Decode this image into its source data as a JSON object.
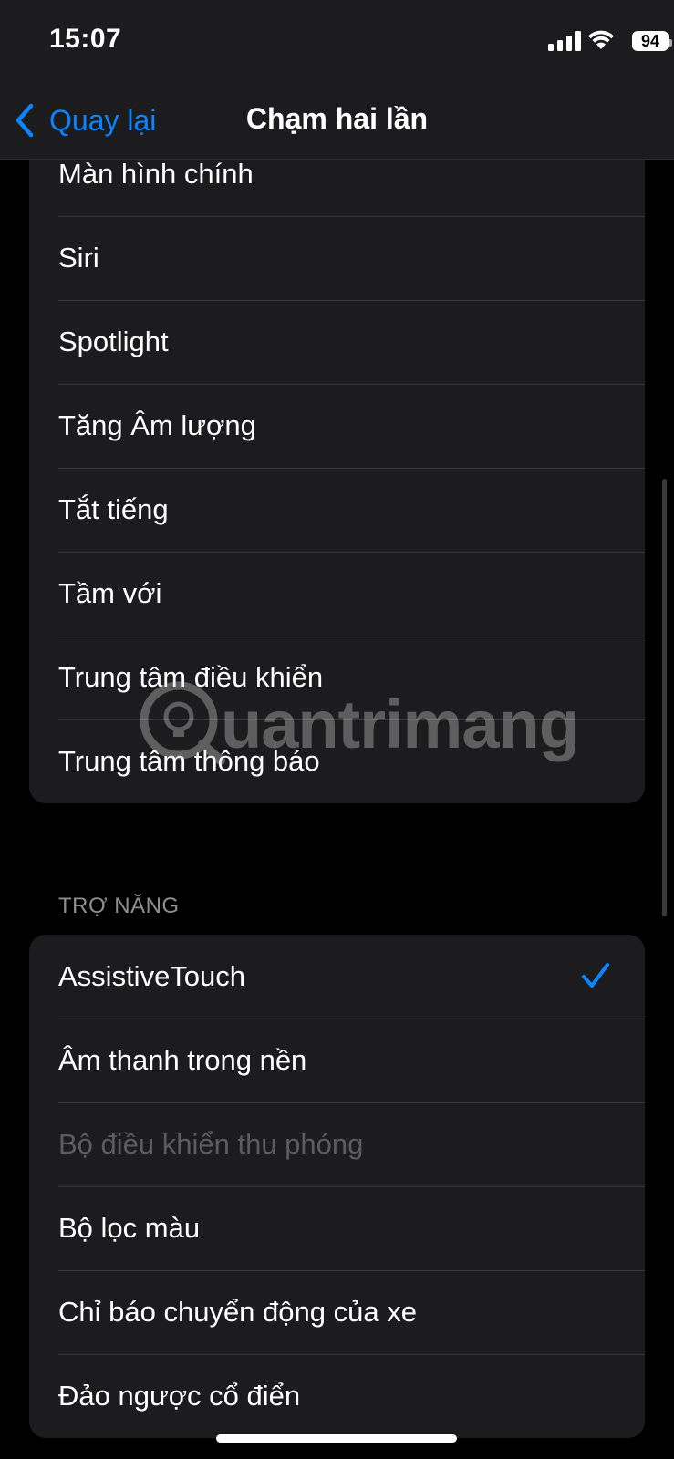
{
  "status_bar": {
    "time": "15:07",
    "battery": "94",
    "icons": [
      "cellular-signal-icon",
      "wifi-icon",
      "battery-icon"
    ]
  },
  "nav": {
    "back_label": "Quay lại",
    "title": "Chạm hai lần"
  },
  "system_group": {
    "items": [
      {
        "label": "Màn hình chính"
      },
      {
        "label": "Siri"
      },
      {
        "label": "Spotlight"
      },
      {
        "label": "Tăng Âm lượng"
      },
      {
        "label": "Tắt tiếng"
      },
      {
        "label": "Tầm với"
      },
      {
        "label": "Trung tâm điều khiển"
      },
      {
        "label": "Trung tâm thông báo"
      }
    ]
  },
  "accessibility_section": {
    "header": "TRỢ NĂNG",
    "items": [
      {
        "label": "AssistiveTouch",
        "selected": true
      },
      {
        "label": "Âm thanh trong nền"
      },
      {
        "label": "Bộ điều khiển thu phóng",
        "disabled": true
      },
      {
        "label": "Bộ lọc màu"
      },
      {
        "label": "Chỉ báo chuyển động của xe"
      },
      {
        "label": "Đảo ngược cổ điển"
      }
    ]
  },
  "watermark": {
    "text": "uantrimang"
  },
  "colors": {
    "accent": "#0a84ff",
    "background": "#000000",
    "cell": "#1c1c1e",
    "disabled_text": "#5c5c60"
  }
}
